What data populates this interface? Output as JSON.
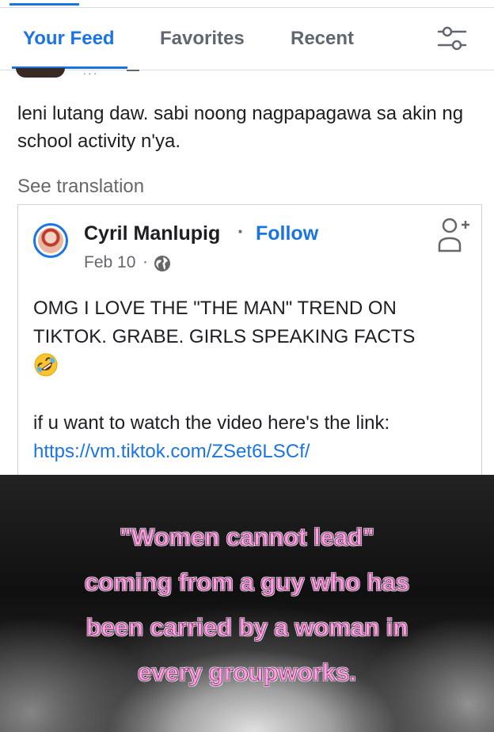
{
  "tabs": {
    "your_feed": "Your Feed",
    "favorites": "Favorites",
    "recent": "Recent"
  },
  "post": {
    "text": "leni lutang daw. sabi noong nagpapagawa sa akin ng school activity n'ya.",
    "see_translation": "See translation"
  },
  "shared_post": {
    "author": "Cyril Manlupig",
    "separator": "·",
    "follow": "Follow",
    "date": "Feb 10",
    "date_separator": "·",
    "audience_icon": "globe-icon",
    "body": "OMG I LOVE THE \"THE MAN\" TREND ON TIKTOK. GRABE. GIRLS SPEAKING FACTS",
    "emoji": "rolling-on-floor-laughing-emoji",
    "link_intro": "if u want to watch the video here's the link:",
    "link": "https://vm.tiktok.com/ZSet6LSCf/"
  },
  "video": {
    "caption_lines": [
      "\"Women cannot lead\"",
      "coming from a guy who has",
      "been carried by a woman in",
      "every groupworks."
    ]
  },
  "colors": {
    "accent": "#1b74e4",
    "secondary_text": "#65676b",
    "caption_pink": "#ff9ee0"
  }
}
